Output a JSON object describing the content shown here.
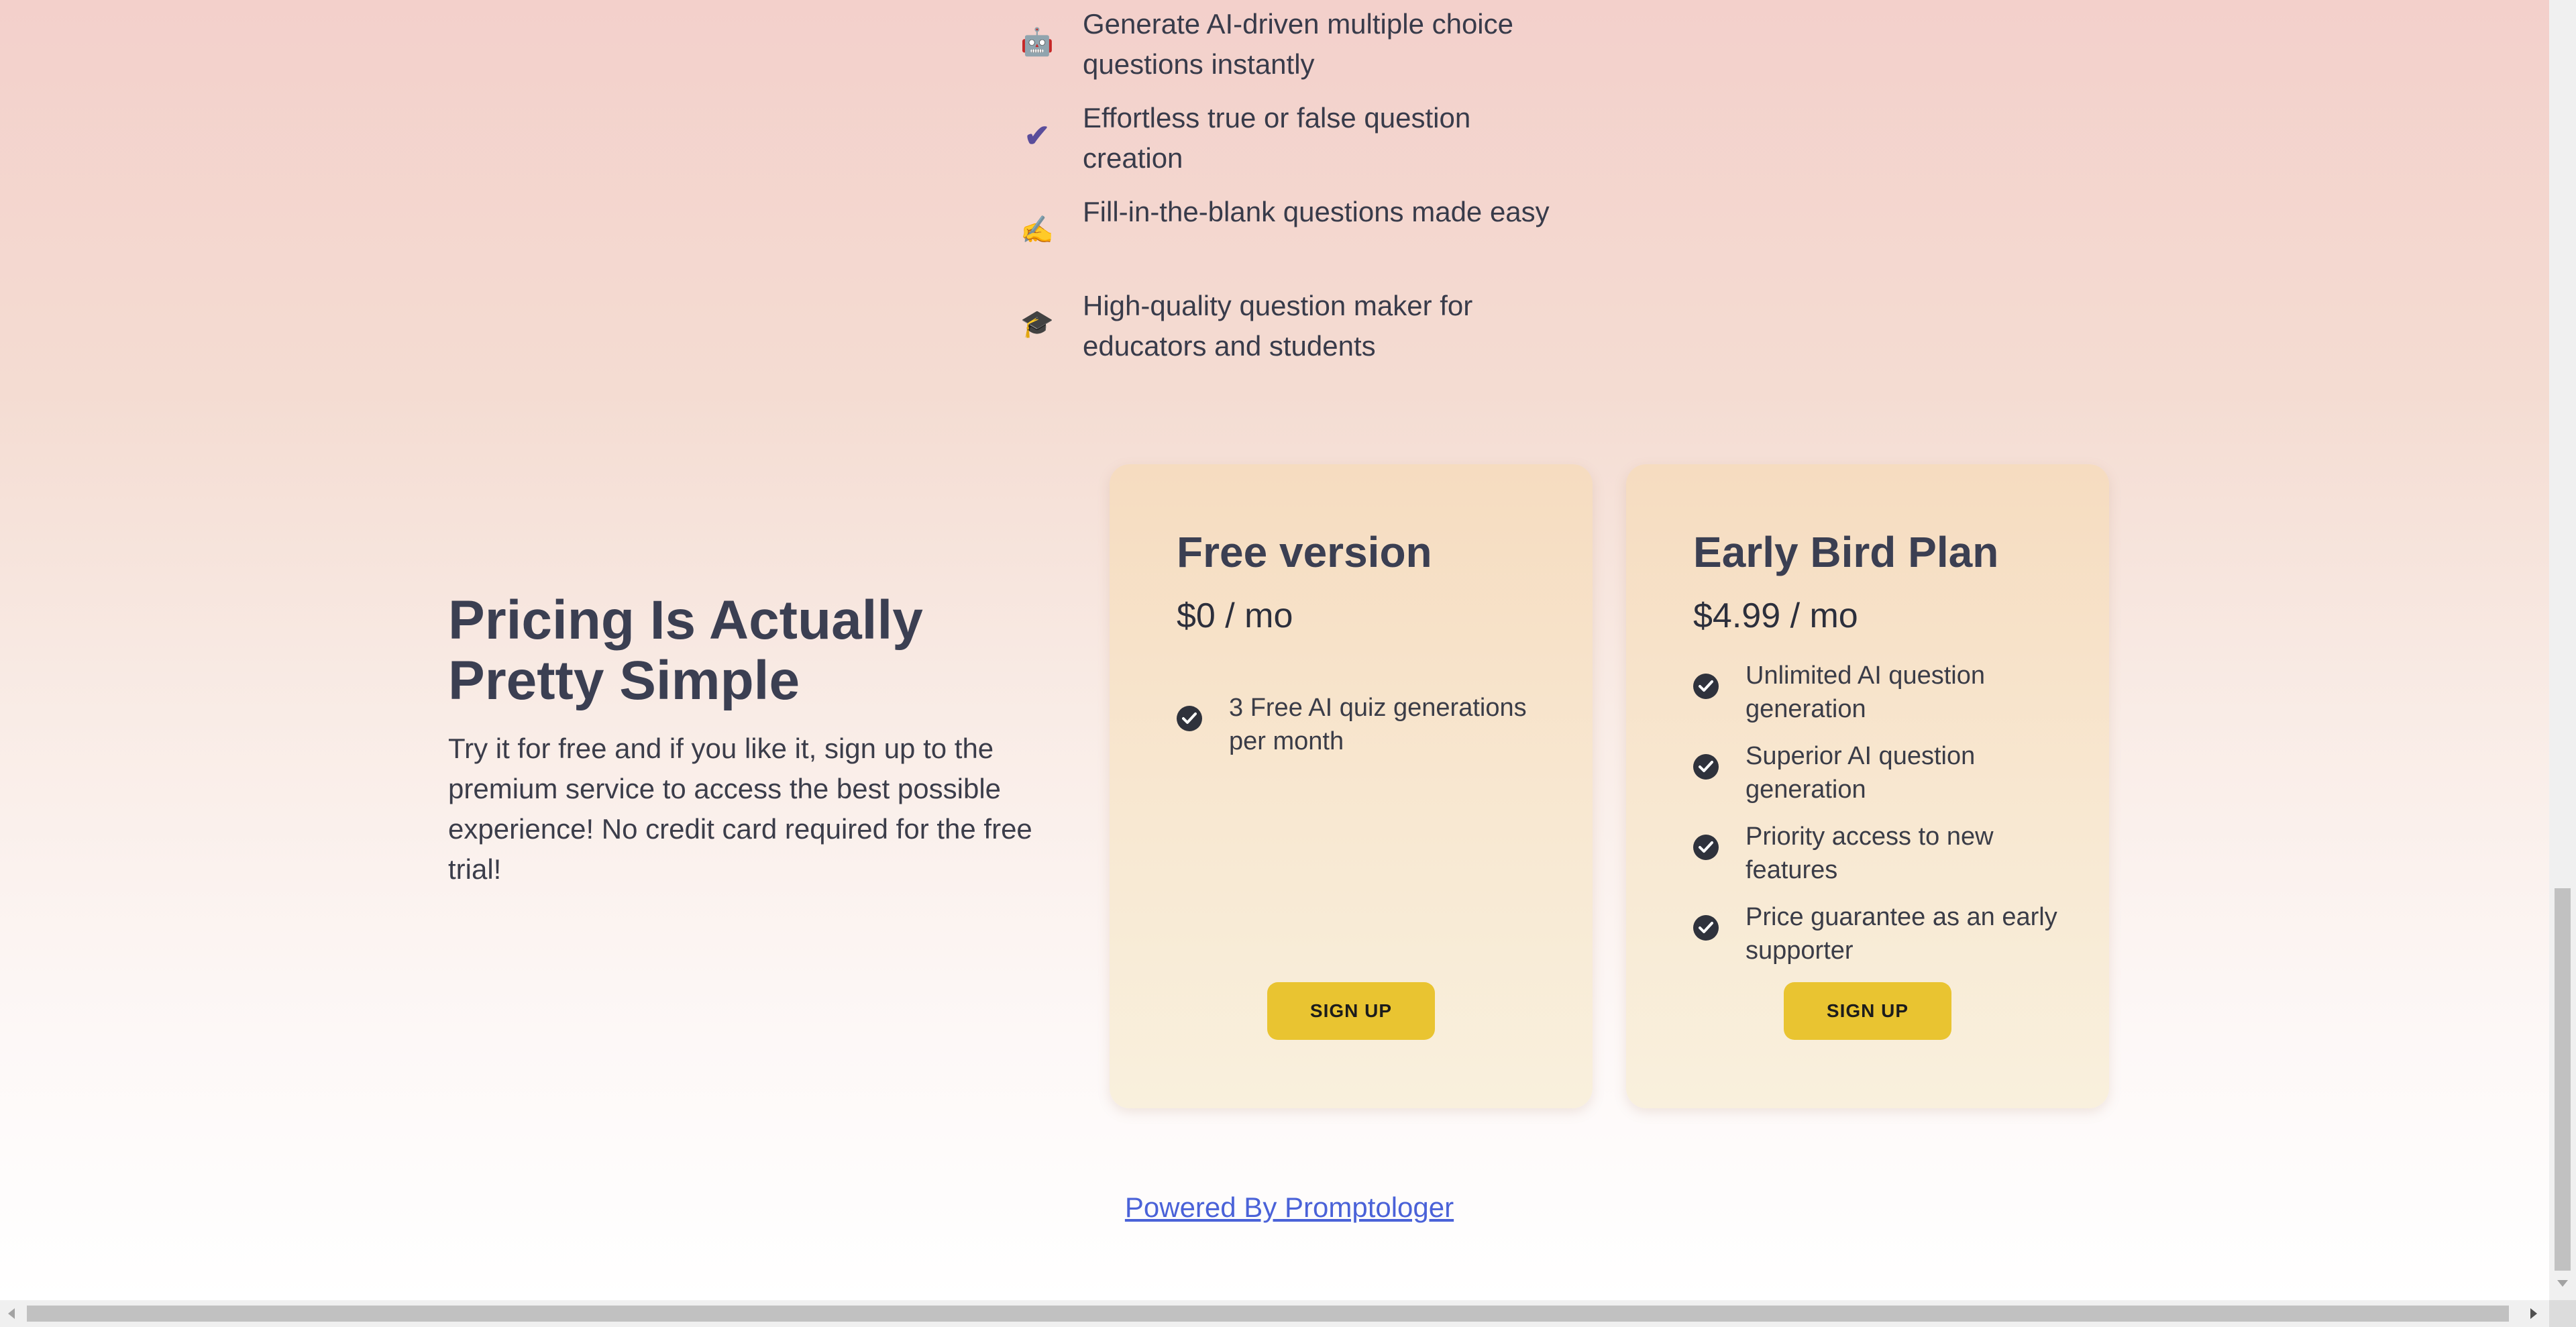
{
  "features": [
    {
      "icon": "robot-icon",
      "glyph": "🤖",
      "text": "Generate AI-driven multiple choice questions instantly"
    },
    {
      "icon": "checkmark-icon",
      "glyph": "✔",
      "text": "Effortless true or false question creation"
    },
    {
      "icon": "writing-hand-icon",
      "glyph": "✍",
      "text": "Fill-in-the-blank questions made easy"
    },
    {
      "icon": "graduation-cap-icon",
      "glyph": "🎓",
      "text": "High-quality question maker for educators and students"
    }
  ],
  "pricing": {
    "title": "Pricing Is Actually Pretty Simple",
    "description": "Try it for free and if you like it, sign up to the premium service to access the best possible experience! No credit card required for the free trial!"
  },
  "plans": [
    {
      "name": "Free version",
      "price": "$0 / mo",
      "features": [
        "3 Free AI quiz generations per month"
      ],
      "button": "SIGN UP"
    },
    {
      "name": "Early Bird Plan",
      "price": "$4.99 / mo",
      "features": [
        "Unlimited AI question generation",
        "Superior AI question generation",
        "Priority access to new features",
        "Price guarantee as an early supporter"
      ],
      "button": "SIGN UP"
    }
  ],
  "footer": {
    "link_text": "Powered By Promptologer"
  },
  "colors": {
    "accent_button": "#e9c431",
    "link": "#4a62d8",
    "heading": "#3b3f52"
  }
}
